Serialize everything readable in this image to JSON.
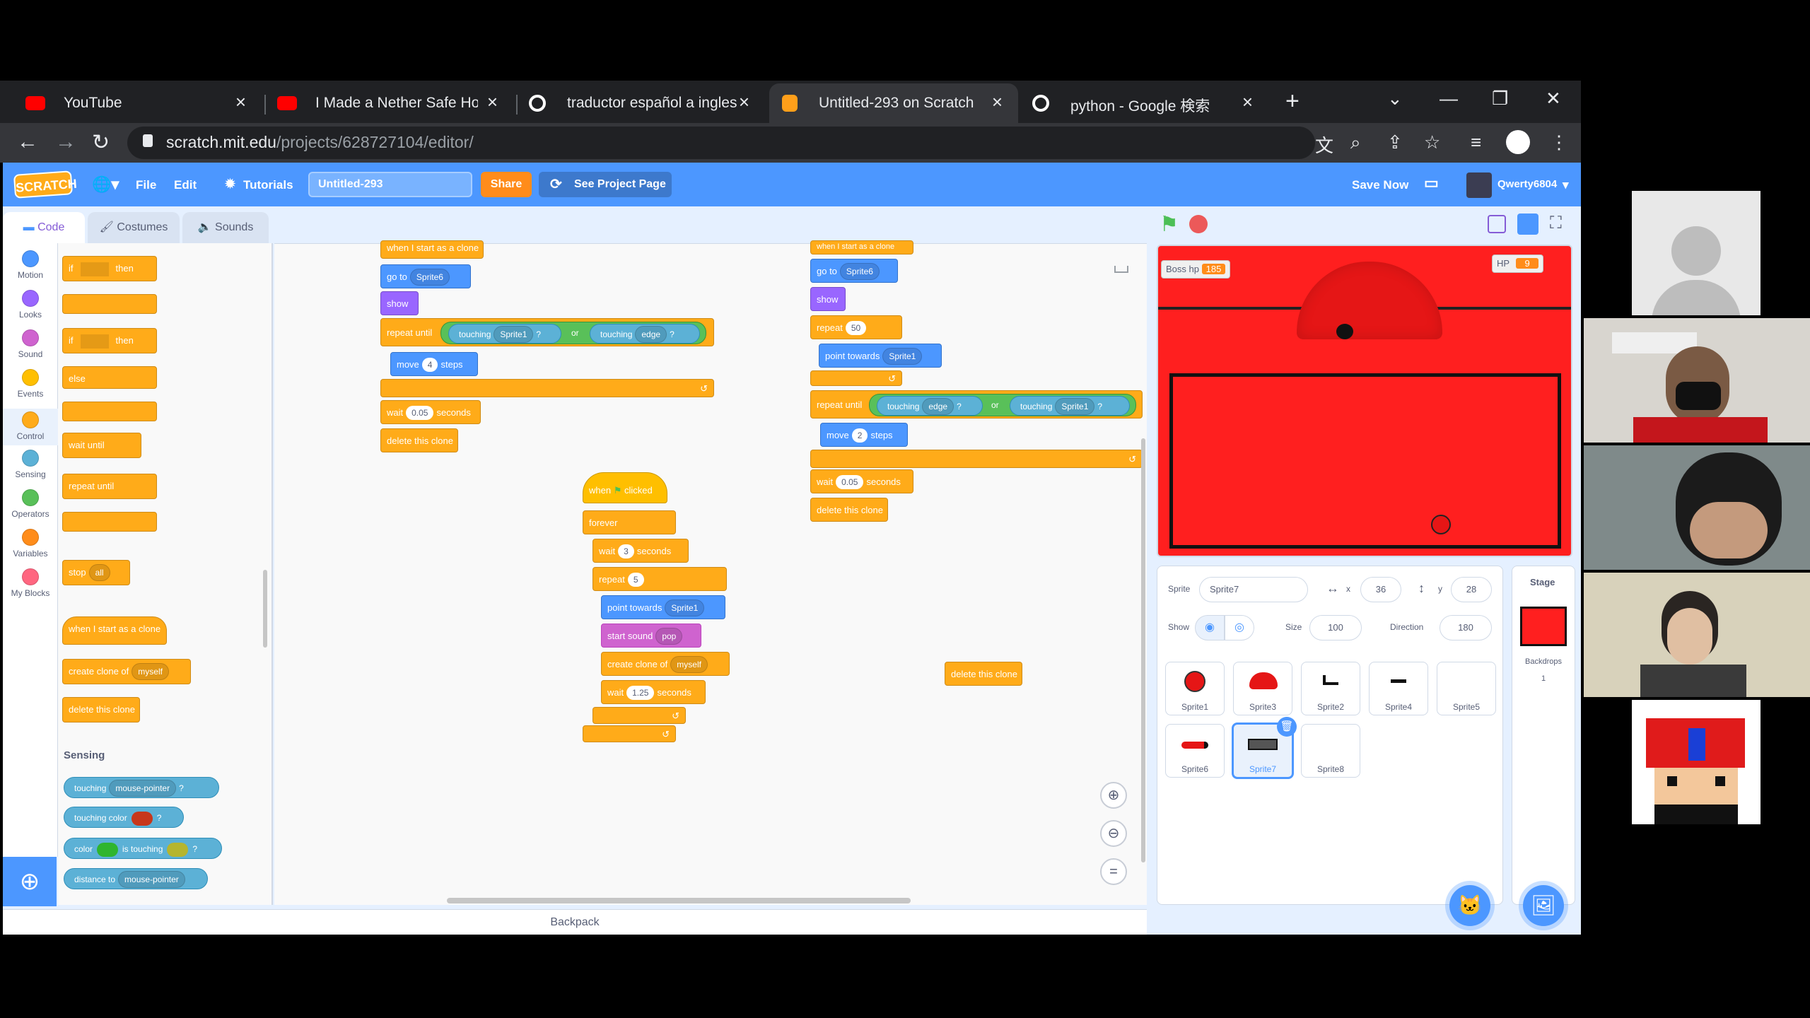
{
  "browser": {
    "tabs": [
      {
        "title": "YouTube",
        "icon": "youtube-icon"
      },
      {
        "title": "I Made a Nether Safe House",
        "icon": "youtube-icon"
      },
      {
        "title": "traductor español a ingles - (",
        "icon": "google-icon"
      },
      {
        "title": "Untitled-293 on Scratch",
        "icon": "scratch-icon",
        "active": true
      },
      {
        "title": "python - Google 検索",
        "icon": "google-icon"
      }
    ],
    "new_tab": "+",
    "url_host": "scratch.mit.edu",
    "url_path": "/projects/628727104/editor/"
  },
  "scratch": {
    "logo": "SCRATCH",
    "menu": {
      "file": "File",
      "edit": "Edit",
      "tutorials": "Tutorials",
      "project_title": "Untitled-293",
      "share": "Share",
      "see_project": "See Project Page",
      "save_now": "Save Now",
      "username": "Qwerty6804"
    },
    "editor_tabs": {
      "code": "Code",
      "costumes": "Costumes",
      "sounds": "Sounds"
    },
    "categories": [
      {
        "label": "Motion",
        "color": "#4c97ff"
      },
      {
        "label": "Looks",
        "color": "#9966ff"
      },
      {
        "label": "Sound",
        "color": "#cf63cf"
      },
      {
        "label": "Events",
        "color": "#ffbf00"
      },
      {
        "label": "Control",
        "color": "#ffab19"
      },
      {
        "label": "Sensing",
        "color": "#5cb1d6"
      },
      {
        "label": "Operators",
        "color": "#59c059"
      },
      {
        "label": "Variables",
        "color": "#ff8c1a"
      },
      {
        "label": "My Blocks",
        "color": "#ff6680"
      }
    ],
    "palette": {
      "if_then_1": {
        "a": "if",
        "b": "then"
      },
      "if_then_2": {
        "a": "if",
        "b": "then"
      },
      "else": "else",
      "wait_until": "wait until",
      "repeat_until": "repeat until",
      "stop": "stop",
      "stop_opt": "all",
      "start_clone": "when I start as a clone",
      "create_clone": "create clone of",
      "create_clone_opt": "myself",
      "delete_clone": "delete this clone",
      "sensing_heading": "Sensing",
      "touching": "touching",
      "touching_opt": "mouse-pointer",
      "touching_color": "touching color",
      "color": "color",
      "is_touching": "is touching",
      "distance_to": "distance to",
      "distance_opt": "mouse-pointer",
      "q": "?"
    },
    "script1": {
      "hat": "when I start as a clone",
      "goto": "go to",
      "goto_opt": "Sprite6",
      "show": "show",
      "repeat_until": "repeat until",
      "touching": "touching",
      "opt1": "Sprite1",
      "or": "or",
      "opt2": "edge",
      "move": "move",
      "move_val": "4",
      "steps": "steps",
      "wait": "wait",
      "wait_val": "0.05",
      "seconds": "seconds",
      "delete": "delete this clone"
    },
    "script2": {
      "hat": "when",
      "flag": "clicked",
      "forever": "forever",
      "wait": "wait",
      "wait_val": "3",
      "seconds": "seconds",
      "repeat": "repeat",
      "repeat_val": "5",
      "point": "point towards",
      "point_opt": "Sprite1",
      "sound": "start sound",
      "sound_opt": "pop",
      "create": "create clone of",
      "create_opt": "myself",
      "wait2_val": "1.25"
    },
    "script3": {
      "hat": "when I start as a clone",
      "goto": "go to",
      "goto_opt": "Sprite6",
      "show": "show",
      "repeat": "repeat",
      "repeat_val": "50",
      "point": "point towards",
      "point_opt": "Sprite1",
      "repeat_until": "repeat until",
      "touching": "touching",
      "opt1": "edge",
      "or": "or",
      "opt2": "Sprite1",
      "move": "move",
      "move_val": "2",
      "steps": "steps",
      "wait": "wait",
      "wait_val": "0.05",
      "seconds": "seconds",
      "delete": "delete this clone"
    },
    "loose_block": "delete this clone",
    "backpack": "Backpack",
    "stage": {
      "boss_label": "Boss hp",
      "boss_val": "185",
      "hp_label": "HP",
      "hp_val": "9"
    },
    "sprite_info": {
      "sprite_label": "Sprite",
      "sprite_name": "Sprite7",
      "x_label": "x",
      "x_val": "36",
      "y_label": "y",
      "y_val": "28",
      "show_label": "Show",
      "size_label": "Size",
      "size_val": "100",
      "direction_label": "Direction",
      "direction_val": "180"
    },
    "sprites": [
      "Sprite1",
      "Sprite3",
      "Sprite2",
      "Sprite4",
      "Sprite5",
      "Sprite6",
      "Sprite7",
      "Sprite8"
    ],
    "stage_panel": {
      "title": "Stage",
      "backdrops_label": "Backdrops",
      "backdrops_count": "1"
    }
  }
}
